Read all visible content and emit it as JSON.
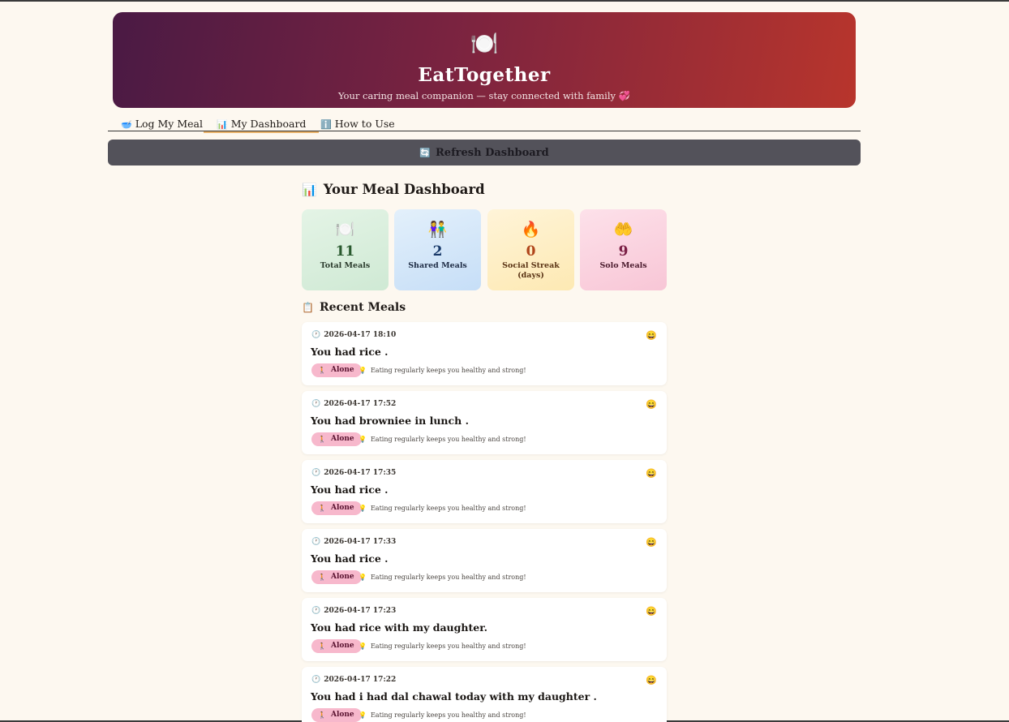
{
  "header": {
    "icon": "plate-fork-knife-icon",
    "icon_glyph": "🍽️",
    "title": "EatTogether",
    "subtitle": "Your caring meal companion — stay connected with family 💞"
  },
  "tabs": [
    {
      "icon": "bowl-icon",
      "glyph": "🥣",
      "label": "Log My Meal",
      "active": false
    },
    {
      "icon": "bar-chart-icon",
      "glyph": "📊",
      "label": "My Dashboard",
      "active": true
    },
    {
      "icon": "info-icon",
      "glyph": "ℹ️",
      "label": "How to Use",
      "active": false
    }
  ],
  "refresh_button": {
    "icon": "refresh-icon",
    "glyph": "🔄",
    "label": "Refresh Dashboard"
  },
  "dashboard": {
    "title_icon": "📊",
    "title": "Your Meal Dashboard",
    "stats": [
      {
        "icon": "plate-icon",
        "glyph": "🍽️",
        "value": "11",
        "label": "Total Meals"
      },
      {
        "icon": "people-icon",
        "glyph": "👫",
        "value": "2",
        "label": "Shared Meals"
      },
      {
        "icon": "fire-icon",
        "glyph": "🔥",
        "value": "0",
        "label": "Social Streak (days)"
      },
      {
        "icon": "open-hands-icon",
        "glyph": "🤲",
        "value": "9",
        "label": "Solo Meals"
      }
    ],
    "recent_title_icon": "📋",
    "recent_title": "Recent Meals",
    "meals": [
      {
        "time": "2026-04-17 18:10",
        "text": "You had rice .",
        "mood": "😄",
        "badge": "Alone",
        "tip": "Eating regularly keeps you healthy and strong!"
      },
      {
        "time": "2026-04-17 17:52",
        "text": "You had browniee in lunch .",
        "mood": "😄",
        "badge": "Alone",
        "tip": "Eating regularly keeps you healthy and strong!"
      },
      {
        "time": "2026-04-17 17:35",
        "text": "You had rice .",
        "mood": "😄",
        "badge": "Alone",
        "tip": "Eating regularly keeps you healthy and strong!"
      },
      {
        "time": "2026-04-17 17:33",
        "text": "You had rice .",
        "mood": "😄",
        "badge": "Alone",
        "tip": "Eating regularly keeps you healthy and strong!"
      },
      {
        "time": "2026-04-17 17:23",
        "text": "You had rice with my daughter.",
        "mood": "😄",
        "badge": "Alone",
        "tip": "Eating regularly keeps you healthy and strong!"
      },
      {
        "time": "2026-04-17 17:22",
        "text": "You had i had dal chawal today with my daughter .",
        "mood": "😄",
        "badge": "Alone",
        "tip": "Eating regularly keeps you healthy and strong!"
      }
    ]
  }
}
